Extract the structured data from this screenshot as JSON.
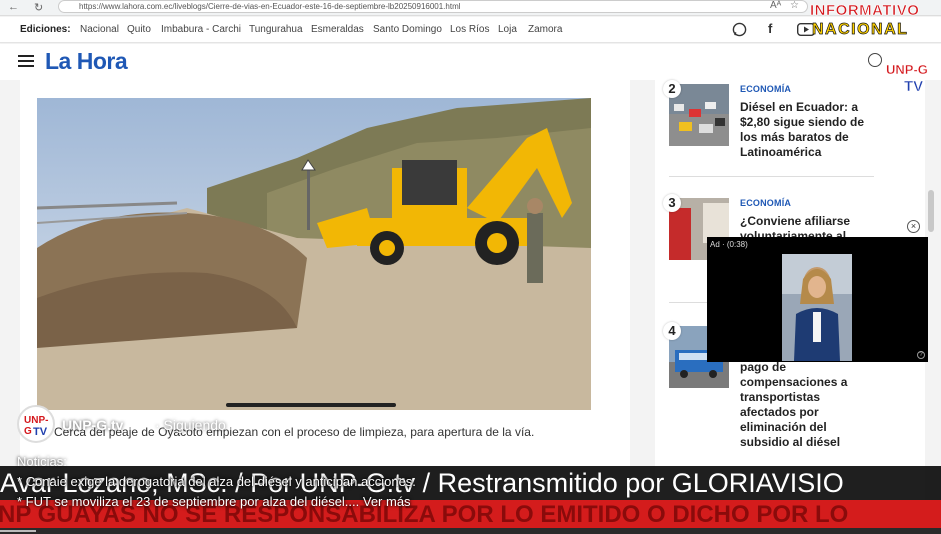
{
  "browser": {
    "url": "https://www.lahora.com.ec/liveblogs/Cierre-de-vias-en-Ecuador-este-16-de-septiembre-lb20250916001.html"
  },
  "editions_bar": {
    "label": "Ediciones:",
    "items": [
      "Nacional",
      "Quito",
      "Imbabura - Carchi",
      "Tungurahua",
      "Esmeraldas",
      "Santo Domingo",
      "Los Ríos",
      "Loja",
      "Zamora"
    ]
  },
  "site": {
    "logo": "La Hora"
  },
  "article": {
    "caption": "Cerca del peaje de Oyacoto empiezan con el proceso de limpieza, para apertura de la vía."
  },
  "sidebar": {
    "items": [
      {
        "number": "2",
        "category": "ECONOMÍA",
        "title": "Diésel en Ecuador: a $2,80 sigue siendo de los más baratos de Latinoamérica"
      },
      {
        "number": "3",
        "category": "ECONOMÍA",
        "title": "¿Conviene afiliarse voluntariamente al"
      },
      {
        "number": "4",
        "category": "",
        "title": "pago de compensaciones a transportistas afectados por eliminación del subsidio al diésel"
      }
    ]
  },
  "ad": {
    "label": "Ad · (0:38)"
  },
  "overlay": {
    "brand_line1": "INFORMATIVO",
    "brand_line2": "NACIONAL",
    "unp_top": "UNP-G",
    "unp_bottom": "TV",
    "channel_name": "UNP-G.tv",
    "following": "· Siguiendo",
    "news_label": "Noticias:",
    "news_lines": [
      "* Conaie exige la derogatoria del alza del diésel y anticipan acciones.",
      "* FUT se moviliza el 23 de septiembre por alza del diésel.... Ver más"
    ],
    "ticker_black": "Avar Lozano, MSc. / Por UNP-G.tv / Restransmitido por GLORIAVISIO",
    "ticker_red": "NP GUAYAS NO SE RESPONSABILIZA POR LO EMITIDO O DICHO POR LO"
  },
  "colors": {
    "brand_blue": "#1f58b5",
    "ticker_red": "#d41c1c",
    "info_red": "#d4171c",
    "info_yellow": "#ffd200"
  }
}
